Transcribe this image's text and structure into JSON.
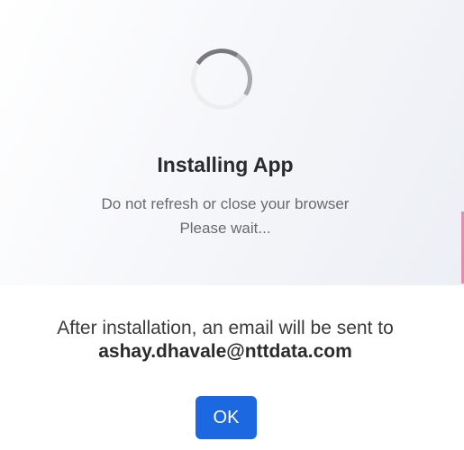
{
  "progress": {
    "title": "Installing App",
    "message_line1": "Do not refresh or close your browser",
    "message_line2": "Please wait...",
    "spinner_icon": "loading-spinner-icon"
  },
  "info": {
    "message": "After installation, an email will be sent to",
    "email": "ashay.dhavale@nttdata.com"
  },
  "actions": {
    "ok_label": "OK"
  },
  "colors": {
    "accent": "#1b68e0",
    "title_text": "#2b2b2e",
    "secondary_text": "#6a6a6e"
  }
}
